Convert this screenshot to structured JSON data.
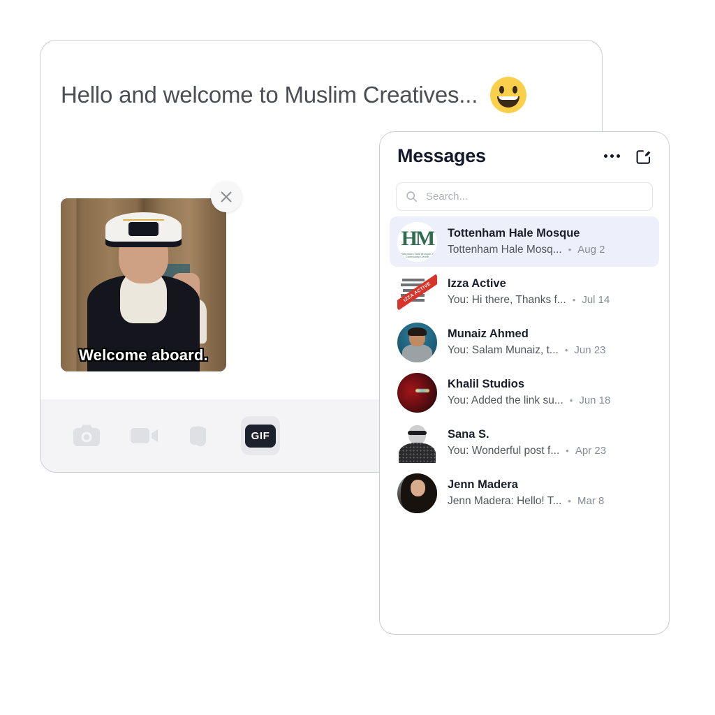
{
  "composer": {
    "headline": "Hello and welcome to Muslim Creatives...",
    "headline_emoji": "😀",
    "emoji_name": "grinning-face",
    "attachment": {
      "type": "gif",
      "caption": "Welcome aboard.",
      "remove_label": "×",
      "remove_name": "remove-attachment"
    },
    "toolbar": {
      "camera_label": "Camera",
      "video_label": "Video",
      "attachment_label": "Attachment",
      "gif_label": "GIF"
    }
  },
  "messages": {
    "title": "Messages",
    "more_label": "More options",
    "compose_label": "New message",
    "search": {
      "placeholder": "Search...",
      "value": ""
    },
    "conversations": [
      {
        "name": "Tottenham Hale Mosque",
        "preview": "Tottenham Hale Mosq...",
        "separator": "•",
        "date": "Aug 2",
        "selected": true,
        "avatar": "thm-logo",
        "avatar_mono": "HM",
        "avatar_sub": "Tottenham Hale Mosque & Community Centre"
      },
      {
        "name": "Izza Active",
        "preview": "You: Hi there, Thanks f...",
        "separator": "•",
        "date": "Jul 14",
        "selected": false,
        "avatar": "izza-logo",
        "avatar_banner": "IZZA ACTIVE"
      },
      {
        "name": "Munaiz Ahmed",
        "preview": "You: Salam Munaiz, t...",
        "separator": "•",
        "date": "Jun 23",
        "selected": false,
        "avatar": "munaiz-photo"
      },
      {
        "name": "Khalil Studios",
        "preview": "You: Added the link su...",
        "separator": "•",
        "date": "Jun 18",
        "selected": false,
        "avatar": "khalil-photo"
      },
      {
        "name": "Sana S.",
        "preview": "You: Wonderful post f...",
        "separator": "•",
        "date": "Apr 23",
        "selected": false,
        "avatar": "sana-photo"
      },
      {
        "name": "Jenn Madera",
        "preview": "Jenn Madera: Hello! T...",
        "separator": "•",
        "date": "Mar 8",
        "selected": false,
        "avatar": "jenn-photo"
      }
    ]
  },
  "colors": {
    "selected_row": "#edf0fa",
    "toolbar_bg": "#f4f4f6",
    "gif_badge_bg": "#1d212e",
    "card_border": "#c9ccd1",
    "name_text": "#1b1e2b",
    "preview_text": "#52555c",
    "date_text": "#868c95"
  }
}
